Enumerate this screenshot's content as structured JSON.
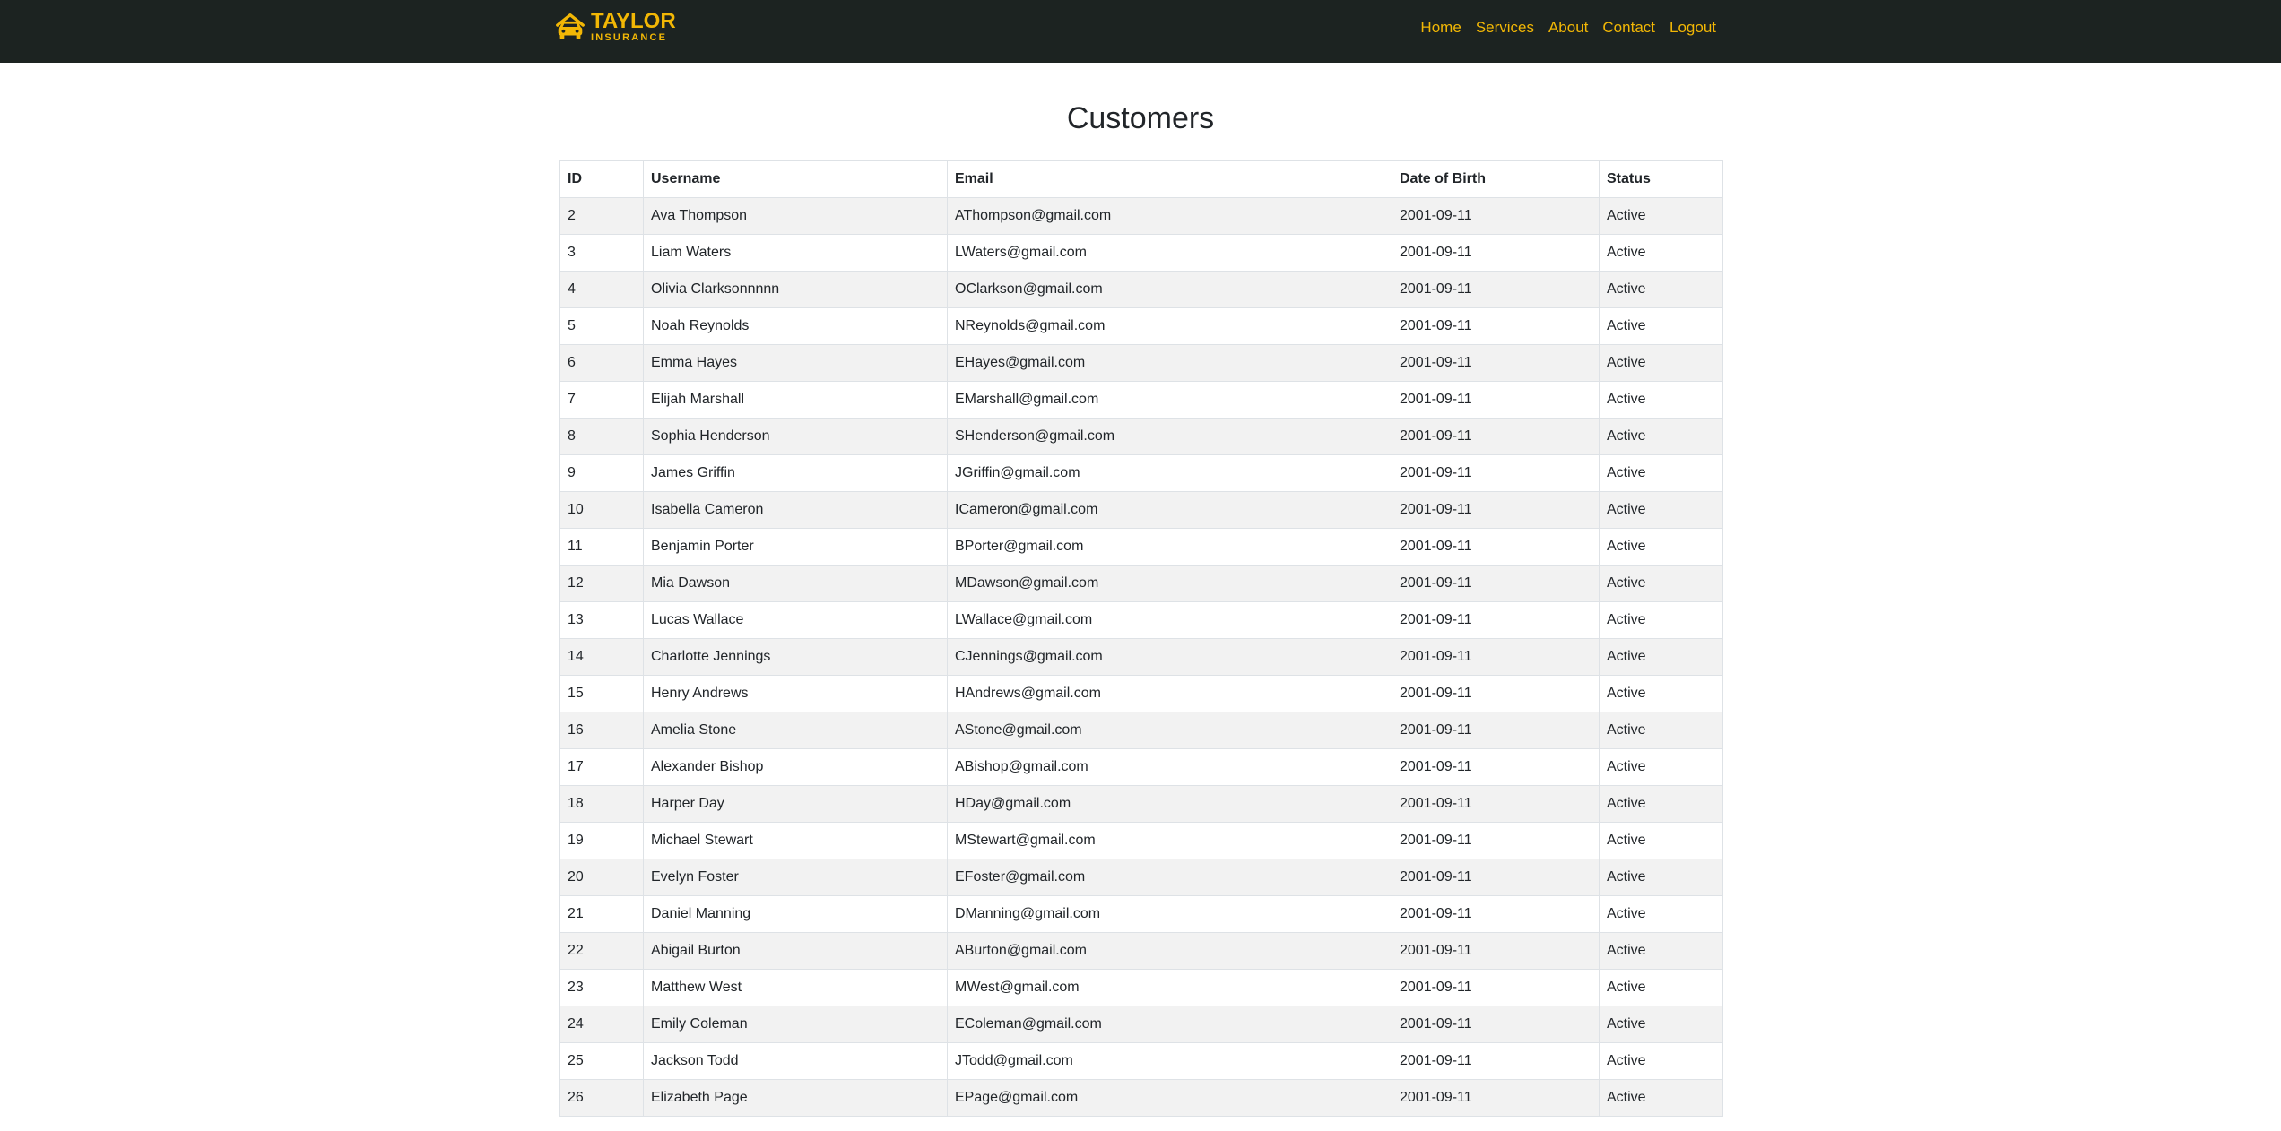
{
  "brand": {
    "title": "TAYLOR",
    "subtitle": "INSURANCE",
    "color": "#f2b705",
    "icon": "car-icon"
  },
  "nav": {
    "background": "#1c2321",
    "links": [
      "Home",
      "Services",
      "About",
      "Contact",
      "Logout"
    ]
  },
  "page": {
    "title": "Customers"
  },
  "table": {
    "columns": [
      "ID",
      "Username",
      "Email",
      "Date of Birth",
      "Status"
    ],
    "rows": [
      [
        "2",
        "Ava Thompson",
        "AThompson@gmail.com",
        "2001-09-11",
        "Active"
      ],
      [
        "3",
        "Liam Waters",
        "LWaters@gmail.com",
        "2001-09-11",
        "Active"
      ],
      [
        "4",
        "Olivia Clarksonnnnn",
        "OClarkson@gmail.com",
        "2001-09-11",
        "Active"
      ],
      [
        "5",
        "Noah Reynolds",
        "NReynolds@gmail.com",
        "2001-09-11",
        "Active"
      ],
      [
        "6",
        "Emma Hayes",
        "EHayes@gmail.com",
        "2001-09-11",
        "Active"
      ],
      [
        "7",
        "Elijah Marshall",
        "EMarshall@gmail.com",
        "2001-09-11",
        "Active"
      ],
      [
        "8",
        "Sophia Henderson",
        "SHenderson@gmail.com",
        "2001-09-11",
        "Active"
      ],
      [
        "9",
        "James Griffin",
        "JGriffin@gmail.com",
        "2001-09-11",
        "Active"
      ],
      [
        "10",
        "Isabella Cameron",
        "ICameron@gmail.com",
        "2001-09-11",
        "Active"
      ],
      [
        "11",
        "Benjamin Porter",
        "BPorter@gmail.com",
        "2001-09-11",
        "Active"
      ],
      [
        "12",
        "Mia Dawson",
        "MDawson@gmail.com",
        "2001-09-11",
        "Active"
      ],
      [
        "13",
        "Lucas Wallace",
        "LWallace@gmail.com",
        "2001-09-11",
        "Active"
      ],
      [
        "14",
        "Charlotte Jennings",
        "CJennings@gmail.com",
        "2001-09-11",
        "Active"
      ],
      [
        "15",
        "Henry Andrews",
        "HAndrews@gmail.com",
        "2001-09-11",
        "Active"
      ],
      [
        "16",
        "Amelia Stone",
        "AStone@gmail.com",
        "2001-09-11",
        "Active"
      ],
      [
        "17",
        "Alexander Bishop",
        "ABishop@gmail.com",
        "2001-09-11",
        "Active"
      ],
      [
        "18",
        "Harper Day",
        "HDay@gmail.com",
        "2001-09-11",
        "Active"
      ],
      [
        "19",
        "Michael Stewart",
        "MStewart@gmail.com",
        "2001-09-11",
        "Active"
      ],
      [
        "20",
        "Evelyn Foster",
        "EFoster@gmail.com",
        "2001-09-11",
        "Active"
      ],
      [
        "21",
        "Daniel Manning",
        "DManning@gmail.com",
        "2001-09-11",
        "Active"
      ],
      [
        "22",
        "Abigail Burton",
        "ABurton@gmail.com",
        "2001-09-11",
        "Active"
      ],
      [
        "23",
        "Matthew West",
        "MWest@gmail.com",
        "2001-09-11",
        "Active"
      ],
      [
        "24",
        "Emily Coleman",
        "EColeman@gmail.com",
        "2001-09-11",
        "Active"
      ],
      [
        "25",
        "Jackson Todd",
        "JTodd@gmail.com",
        "2001-09-11",
        "Active"
      ],
      [
        "26",
        "Elizabeth Page",
        "EPage@gmail.com",
        "2001-09-11",
        "Active"
      ]
    ]
  }
}
